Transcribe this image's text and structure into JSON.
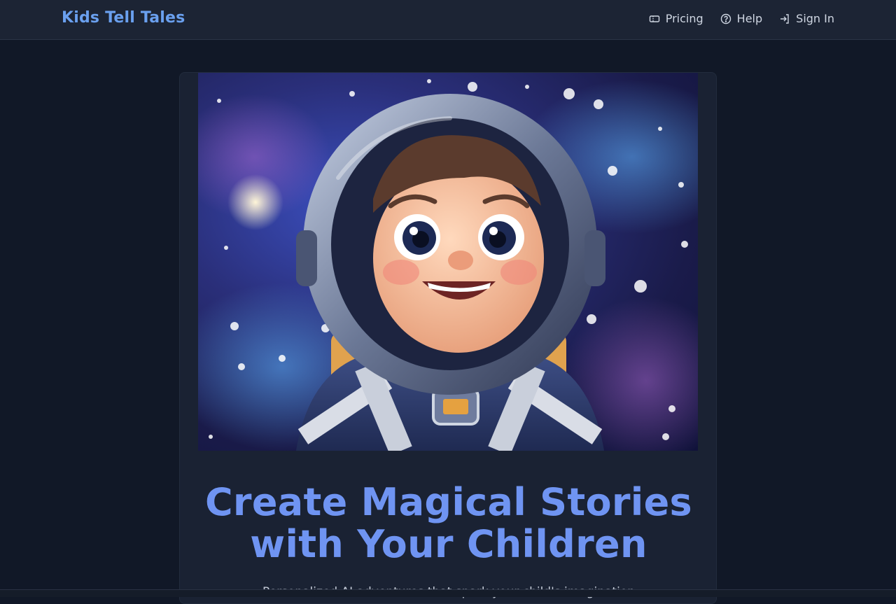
{
  "header": {
    "brand": "Kids Tell Tales",
    "nav": [
      {
        "label": "Pricing",
        "icon": "ticket-icon"
      },
      {
        "label": "Help",
        "icon": "help-circle-icon"
      },
      {
        "label": "Sign In",
        "icon": "sign-in-icon"
      }
    ]
  },
  "hero": {
    "image_subject": "cartoon child astronaut in space",
    "headline_line1": "Create Magical Stories",
    "headline_line2": "with Your Children",
    "subtext": "Personalized AI adventures that spark your child's imagination"
  },
  "colors": {
    "background": "#111827",
    "header": "#1c2434",
    "brand": "#6aa0ef",
    "headline": "#6f94f2"
  }
}
